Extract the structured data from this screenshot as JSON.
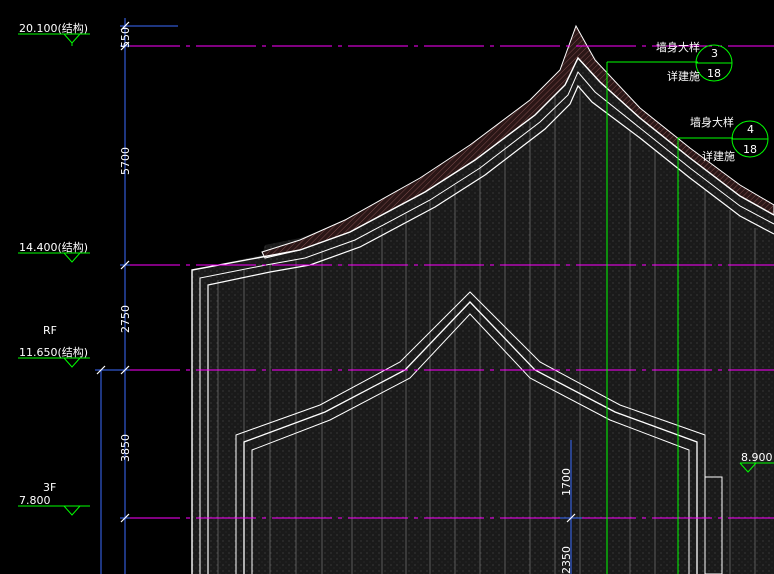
{
  "levels": [
    {
      "label": "20.100(结构)",
      "name": ""
    },
    {
      "label": "14.400(结构)",
      "name": ""
    },
    {
      "label": "11.650(结构)",
      "name": "RF"
    },
    {
      "label": "7.800",
      "name": "3F"
    },
    {
      "label": "8.900",
      "name": ""
    }
  ],
  "dimensions": [
    "550",
    "5700",
    "2750",
    "3850",
    "1700",
    "2350"
  ],
  "callouts": [
    {
      "title": "墙身大样",
      "number": "3",
      "sheet": "18",
      "note": "详建施"
    },
    {
      "title": "墙身大样",
      "number": "4",
      "sheet": "18",
      "note": "详建施"
    }
  ],
  "colors": {
    "background": "#000000",
    "level_line": "#ff00ff",
    "dimension_line": "#3b6cff",
    "marker": "#00ff00",
    "outline": "#ffffff",
    "fill_dark": "#1c1c1c",
    "grid": "#7a7a7a"
  }
}
